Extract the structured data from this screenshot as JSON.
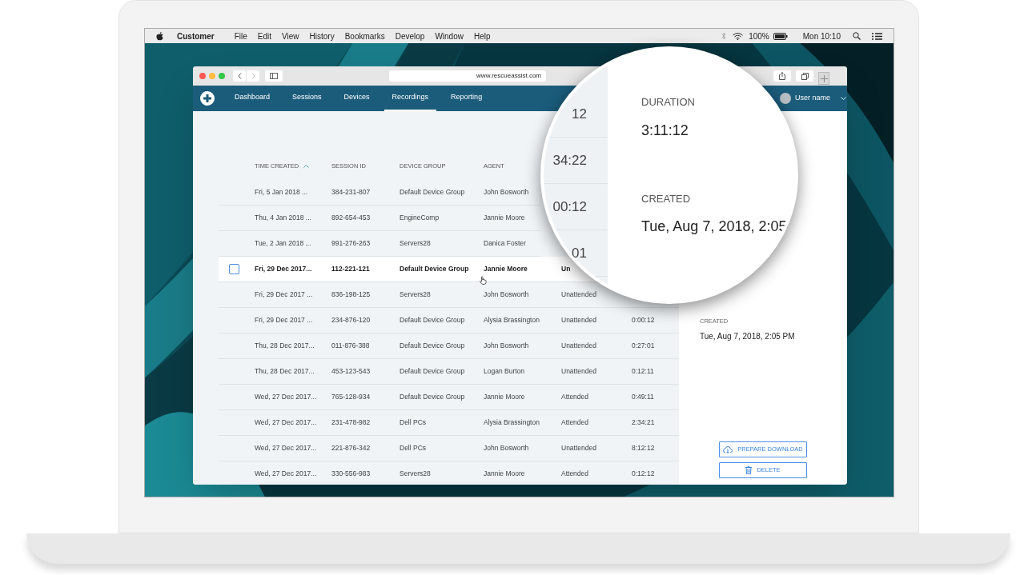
{
  "menubar": {
    "app": "Customer",
    "menus": [
      "File",
      "Edit",
      "View",
      "History",
      "Bookmarks",
      "Develop",
      "Window",
      "Help"
    ],
    "battery": "100%",
    "clock": "Mon 10:10"
  },
  "browser": {
    "url": "www.rescueassist.com"
  },
  "nav": {
    "tabs": [
      {
        "label": "Dashboard",
        "selected": false
      },
      {
        "label": "Sessions",
        "selected": false
      },
      {
        "label": "Devices",
        "selected": false
      },
      {
        "label": "Recordings",
        "selected": true
      },
      {
        "label": "Reporting",
        "selected": false
      }
    ],
    "user": "User name"
  },
  "table": {
    "columns": [
      {
        "label": "TIME CREATED",
        "sorted": true
      },
      {
        "label": "SESSION ID",
        "sorted": false
      },
      {
        "label": "DEVICE GROUP",
        "sorted": false
      },
      {
        "label": "AGENT",
        "sorted": false
      }
    ],
    "rows": [
      {
        "time": "Fri, 5 Jan 2018 ...",
        "session_id": "384-231-807",
        "device_group": "Default Device Group",
        "agent": "John Bosworth",
        "hovered": false
      },
      {
        "time": "Thu, 4 Jan 2018 ...",
        "session_id": "892-654-453",
        "device_group": "EngineComp",
        "agent": "Jannie Moore",
        "hovered": false
      },
      {
        "time": "Tue, 2 Jan 2018 ...",
        "session_id": "991-276-263",
        "device_group": "Servers28",
        "agent": "Danica Foster",
        "hovered": false
      },
      {
        "time": "Fri, 29 Dec 2017...",
        "session_id": "112-221-121",
        "device_group": "Default Device Group",
        "agent": "Jannie Moore",
        "type": "Un",
        "hovered": true
      },
      {
        "time": "Fri, 29 Dec 2017 ...",
        "session_id": "836-198-125",
        "device_group": "Servers28",
        "agent": "John Bosworth",
        "type": "Unattended",
        "hovered": false
      },
      {
        "time": "Fri, 29 Dec 2017 ...",
        "session_id": "234-876-120",
        "device_group": "Default Device Group",
        "agent": "Alysia Brassington",
        "type": "Unattended",
        "duration": "0:00:12",
        "hovered": false
      },
      {
        "time": "Thu, 28 Dec 2017...",
        "session_id": "011-876-388",
        "device_group": "Default Device Group",
        "agent": "John Bosworth",
        "type": "Unattended",
        "duration": "0:27:01",
        "hovered": false
      },
      {
        "time": "Thu, 28 Dec 2017...",
        "session_id": "453-123-543",
        "device_group": "Default Device Group",
        "agent": "Logan Burton",
        "type": "Unattended",
        "duration": "0:12:11",
        "hovered": false
      },
      {
        "time": "Wed, 27 Dec 2017...",
        "session_id": "765-128-934",
        "device_group": "Default Device Group",
        "agent": "Jannie Moore",
        "type": "Attended",
        "duration": "0:49:11",
        "hovered": false
      },
      {
        "time": "Wed, 27 Dec 2017...",
        "session_id": "231-478-982",
        "device_group": "Dell PCs",
        "agent": "Alysia Brassington",
        "type": "Attended",
        "duration": "2:34:21",
        "hovered": false
      },
      {
        "time": "Wed, 27 Dec 2017...",
        "session_id": "221-876-342",
        "device_group": "Dell PCs",
        "agent": "John Bosworth",
        "type": "Unattended",
        "duration": "8:12:12",
        "hovered": false
      },
      {
        "time": "Wed, 27 Dec 2017...",
        "session_id": "330-556-983",
        "device_group": "Servers28",
        "agent": "Jannie Moore",
        "type": "Attended",
        "duration": "0:12:12",
        "hovered": false
      }
    ]
  },
  "details": {
    "fields": [
      {
        "label": "CREATED",
        "value": "Tue, Aug 7, 2018, 2:05 PM"
      }
    ],
    "buttons": [
      {
        "label": "PREPARE DOWNLOAD",
        "kind": "download"
      },
      {
        "label": "DELETE",
        "kind": "delete"
      }
    ]
  },
  "magnifier": {
    "fragments": [
      "12",
      "34:22",
      "00:12",
      "01"
    ],
    "fields": [
      {
        "label": "DURATION",
        "value": "3:11:12"
      },
      {
        "label": "CREATED",
        "value": "Tue, Aug 7, 2018, 2:05"
      }
    ]
  }
}
